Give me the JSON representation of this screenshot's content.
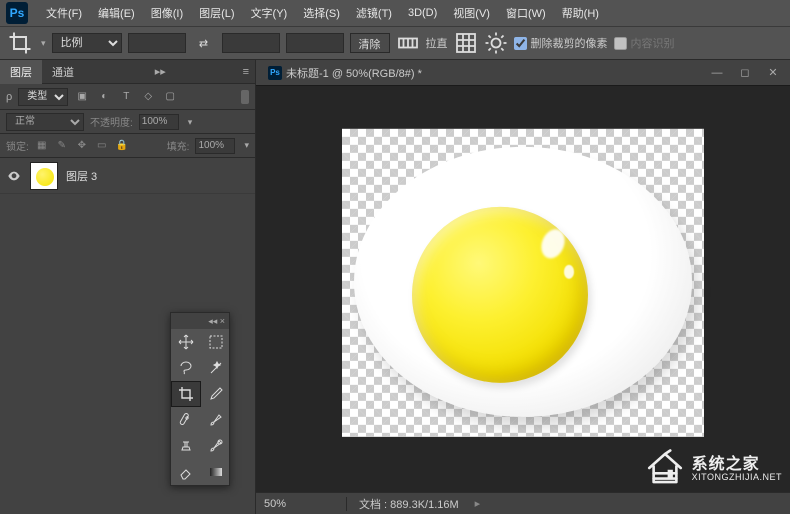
{
  "app": {
    "logo": "Ps"
  },
  "menu": {
    "file": "文件(F)",
    "edit": "编辑(E)",
    "image": "图像(I)",
    "layer": "图层(L)",
    "type": "文字(Y)",
    "select": "选择(S)",
    "filter": "滤镜(T)",
    "threed": "3D(D)",
    "view": "视图(V)",
    "window": "窗口(W)",
    "help": "帮助(H)"
  },
  "options": {
    "preset": "比例",
    "clear": "清除",
    "straighten": "拉直",
    "delete_cropped": "删除裁剪的像素",
    "content_aware": "内容识别"
  },
  "panels": {
    "layers_tab": "图层",
    "channels_tab": "通道",
    "filter_kind": "类型",
    "blend_mode": "正常",
    "opacity_label": "不透明度:",
    "opacity_value": "100%",
    "lock_label": "锁定:",
    "fill_label": "填充:",
    "fill_value": "100%",
    "layer_items": [
      {
        "name": "图层 3",
        "visible": true
      }
    ]
  },
  "document": {
    "title": "未标题-1 @ 50%(RGB/8#) *",
    "zoom": "50%",
    "status": "文档 : 889.3K/1.16M"
  },
  "watermark": {
    "cn": "系统之家",
    "en": "XITONGZHIJIA.NET"
  }
}
